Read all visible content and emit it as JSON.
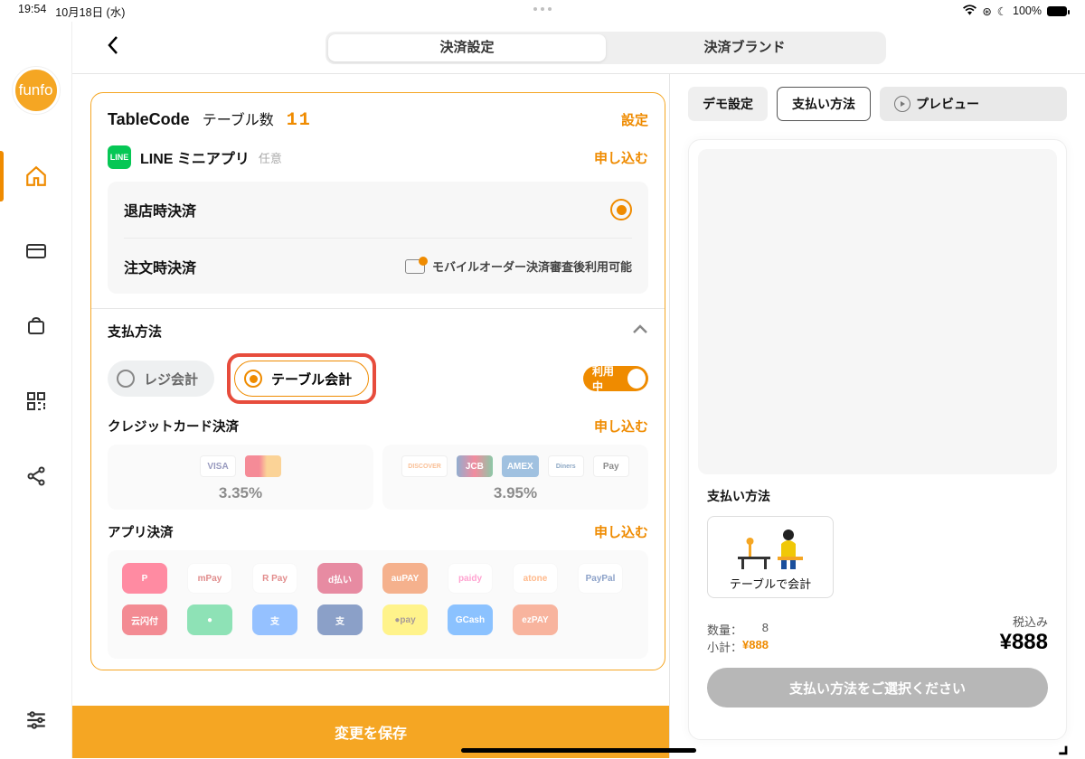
{
  "status": {
    "time": "19:54",
    "date": "10月18日 (水)",
    "battery_pct": "100%"
  },
  "brand": {
    "logo_text": "funfo"
  },
  "header": {
    "tab_settings": "決済設定",
    "tab_brand": "決済ブランド"
  },
  "right_top": {
    "demo": "デモ設定",
    "pay_method": "支払い方法",
    "preview": "プレビュー"
  },
  "preview": {
    "title": "支払い方法",
    "option_label": "テーブルで会計",
    "qty_label": "数量：",
    "qty_value": "8",
    "subtotal_label": "小計：",
    "subtotal_value": "¥888",
    "tax_label": "税込み",
    "total": "¥888",
    "select_btn": "支払い方法をご選択ください"
  },
  "card": {
    "title": "TableCode",
    "table_label": "テーブル数",
    "table_count": "11",
    "settings_link": "設定",
    "line": {
      "badge": "LINE",
      "label": "LINE ミニアプリ",
      "note": "任意",
      "apply": "申し込む"
    },
    "options": {
      "on_exit": "退店時決済",
      "on_order": "注文時決済",
      "mobile_note": "モバイルオーダー決済審査後利用可能"
    },
    "pay_methods": {
      "title": "支払方法",
      "register": "レジ会計",
      "table": "テーブル会計",
      "toggle": "利用中"
    },
    "credit": {
      "title": "クレジットカード決済",
      "apply": "申し込む",
      "rate1": "3.35%",
      "rate2": "3.95%"
    },
    "app_pay": {
      "title": "アプリ決済",
      "apply": "申し込む"
    }
  },
  "save_btn": "変更を保存"
}
